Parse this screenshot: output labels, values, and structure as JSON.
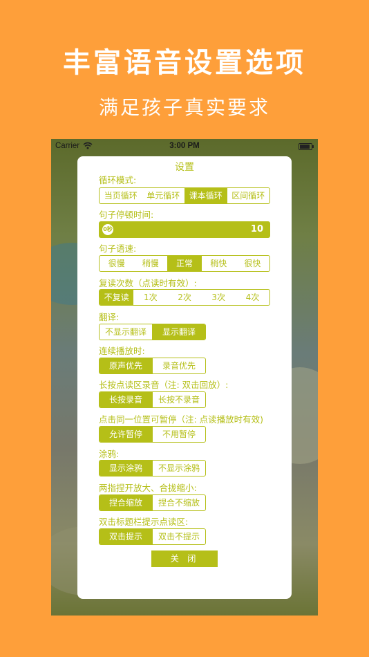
{
  "promo": {
    "headline": "丰富语音设置选项",
    "subline": "满足孩子真实要求"
  },
  "status_bar": {
    "carrier": "Carrier",
    "wifi_icon": "wifi-icon",
    "time": "3:00 PM",
    "battery_icon": "battery-icon"
  },
  "settings": {
    "title": "设置",
    "loop_mode": {
      "label": "循环模式:",
      "options": [
        "当页循环",
        "单元循环",
        "课本循环",
        "区间循环"
      ],
      "selected": 2
    },
    "pause_time": {
      "label": "句子停顿时间:",
      "knob_text": "0秒",
      "value": "10"
    },
    "speed": {
      "label": "句子语速:",
      "options": [
        "很慢",
        "稍慢",
        "正常",
        "稍快",
        "很快"
      ],
      "selected": 2
    },
    "repeat": {
      "label": "复读次数（点读时有效）:",
      "options": [
        "不复读",
        "1次",
        "2次",
        "3次",
        "4次"
      ],
      "selected": 0
    },
    "translate": {
      "label": "翻译:",
      "options": [
        "不显示翻译",
        "显示翻译"
      ],
      "selected": 1
    },
    "continuous": {
      "label": "连续播放时:",
      "options": [
        "原声优先",
        "录音优先"
      ],
      "selected": 0
    },
    "long_press": {
      "label": "长按点读区录音（注: 双击回放）:",
      "options": [
        "长按录音",
        "长按不录音"
      ],
      "selected": 0
    },
    "tap_pause": {
      "label": "点击同一位置可暂停（注: 点读播放时有效)",
      "options": [
        "允许暂停",
        "不用暂停"
      ],
      "selected": 0
    },
    "doodle": {
      "label": "涂鸦:",
      "options": [
        "显示涂鸦",
        "不显示涂鸦"
      ],
      "selected": 0
    },
    "pinch": {
      "label": "两指捏开放大、合拢缩小:",
      "options": [
        "捏合缩放",
        "捏合不缩放"
      ],
      "selected": 0
    },
    "double_tap": {
      "label": "双击标题栏提示点读区:",
      "options": [
        "双击提示",
        "双击不提示"
      ],
      "selected": 0
    },
    "close_label": "关 闭"
  },
  "colors": {
    "background": "#FE9F3A",
    "accent": "#B5BF18"
  }
}
